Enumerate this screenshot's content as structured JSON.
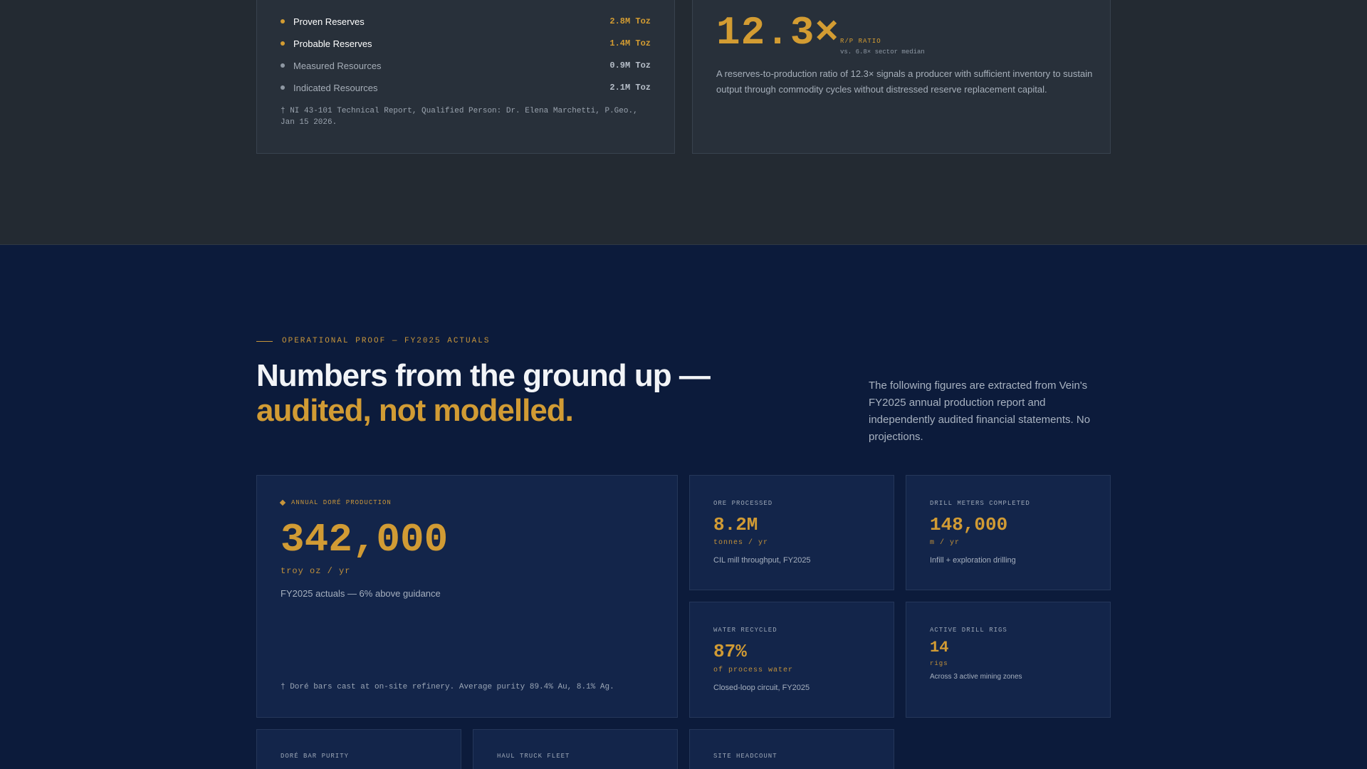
{
  "reserves": {
    "items": [
      {
        "label": "Proven Reserves",
        "value": "2.8M Toz",
        "dot_color": "#d39c32",
        "label_color": "#ffffff",
        "value_color": "#d39c32"
      },
      {
        "label": "Probable Reserves",
        "value": "1.4M Toz",
        "dot_color": "#d39c32",
        "label_color": "#ffffff",
        "value_color": "#d39c32"
      },
      {
        "label": "Measured Resources",
        "value": "0.9M Toz",
        "dot_color": "#8f98a3",
        "label_color": "#a6aeb8",
        "value_color": "#b7bfc9"
      },
      {
        "label": "Indicated Resources",
        "value": "2.1M Toz",
        "dot_color": "#8f98a3",
        "label_color": "#a6aeb8",
        "value_color": "#b7bfc9"
      }
    ],
    "note": "† NI 43-101 Technical Report, Qualified Person: Dr. Elena Marchetti, P.Geo., Jan 15 2026."
  },
  "ratio": {
    "value": "12.3×",
    "label": "R/P RATIO",
    "sub": "vs. 6.8× sector median",
    "description": "A reserves-to-production ratio of 12.3× signals a producer with sufficient inventory to sustain output through commodity cycles without distressed reserve replacement capital."
  },
  "operational": {
    "eyebrow": "OPERATIONAL PROOF — FY2025 ACTUALS",
    "headline_line1": "Numbers from the ground up —",
    "headline_line2": "audited, not modelled.",
    "intro": "The following figures are extracted from Vein's FY2025 annual production report and independently audited financial statements. No projections."
  },
  "metrics": {
    "annual": {
      "label": "ANNUAL DORÉ PRODUCTION",
      "value": "342,000",
      "unit": "troy oz / yr",
      "desc": "FY2025 actuals — 6% above guidance",
      "note": "† Doré bars cast at on-site refinery. Average purity 89.4% Au, 8.1% Ag."
    },
    "ore": {
      "label": "ORE PROCESSED",
      "value": "8.2M",
      "unit": "tonnes / yr",
      "desc": "CIL mill throughput, FY2025"
    },
    "drill": {
      "label": "DRILL METERS COMPLETED",
      "value": "148,000",
      "unit": "m / yr",
      "desc": "Infill + exploration drilling"
    },
    "water": {
      "label": "WATER RECYCLED",
      "value": "87%",
      "unit": "of process water",
      "desc": "Closed-loop circuit, FY2025"
    },
    "rigs": {
      "label": "ACTIVE DRILL RIGS",
      "value": "14",
      "unit": "rigs",
      "desc": "Across 3 active mining zones"
    },
    "purity": {
      "label": "DORÉ BAR PURITY"
    },
    "fleet": {
      "label": "HAUL TRUCK FLEET"
    },
    "headcount": {
      "label": "SITE HEADCOUNT"
    }
  }
}
